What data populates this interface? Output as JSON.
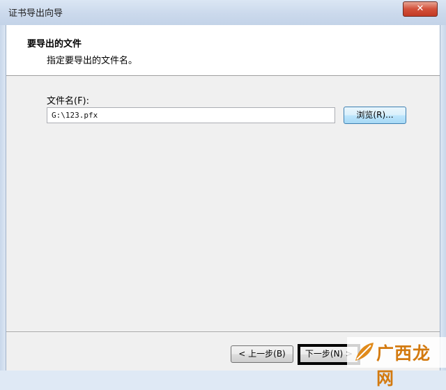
{
  "window": {
    "title": "证书导出向导",
    "close_glyph": "✕"
  },
  "header": {
    "title": "要导出的文件",
    "subtitle": "指定要导出的文件名。"
  },
  "form": {
    "file_label": "文件名(F):",
    "file_value": "G:\\123.pfx",
    "browse_label": "浏览(R)..."
  },
  "buttons": {
    "back_label": "< 上一步(B)",
    "next_label": "下一步(N) >"
  },
  "watermark": {
    "text": "广西龙网",
    "logo_icon": "leaf-icon",
    "color": "#d37a0f"
  },
  "colors": {
    "highlight_box": "#000000",
    "close_button": "#c33b24"
  }
}
